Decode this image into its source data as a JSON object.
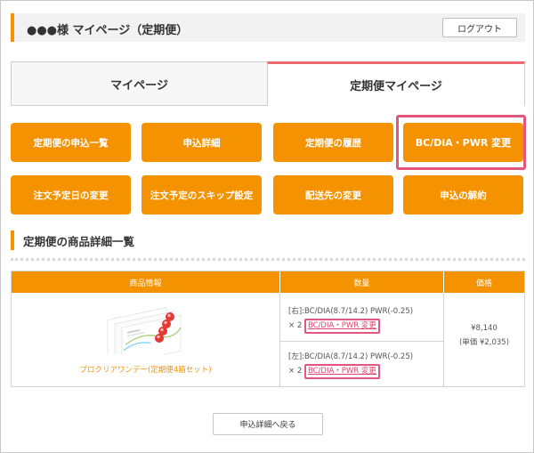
{
  "header": {
    "title": "●●●様 マイページ（定期便）",
    "logout_label": "ログアウト"
  },
  "tabs": [
    {
      "label": "マイページ",
      "active": false
    },
    {
      "label": "定期便マイページ",
      "active": true
    }
  ],
  "actions": {
    "row1": [
      "定期便の申込一覧",
      "申込詳細",
      "定期便の履歴",
      "BC/DiA・PWR 変更"
    ],
    "row2": [
      "注文予定日の変更",
      "注文予定のスキップ設定",
      "配送先の変更",
      "申込の解約"
    ]
  },
  "section": {
    "title": "定期便の商品詳細一覧"
  },
  "table": {
    "headers": {
      "info": "商品情報",
      "qty": "数量",
      "price": "価格"
    },
    "product_name": "プロクリアワンデー(定期便4箱セット)",
    "rows": [
      {
        "spec": "[右]:BC/DIA(8.7/14.2) PWR(-0.25)",
        "qty": "× 2",
        "link": "BC/DIA・PWR 変更"
      },
      {
        "spec": "[左]:BC/DIA(8.7/14.2) PWR(-0.25)",
        "qty": "× 2",
        "link": "BC/DIA・PWR 変更"
      }
    ],
    "price": "¥8,140",
    "unit_price": "(単価 ¥2,035)"
  },
  "footer": {
    "back_label": "申込詳細へ戻る"
  },
  "colors": {
    "accent": "#f49200",
    "highlight": "#e4557f",
    "tab_active_border": "#ef6a6f"
  }
}
